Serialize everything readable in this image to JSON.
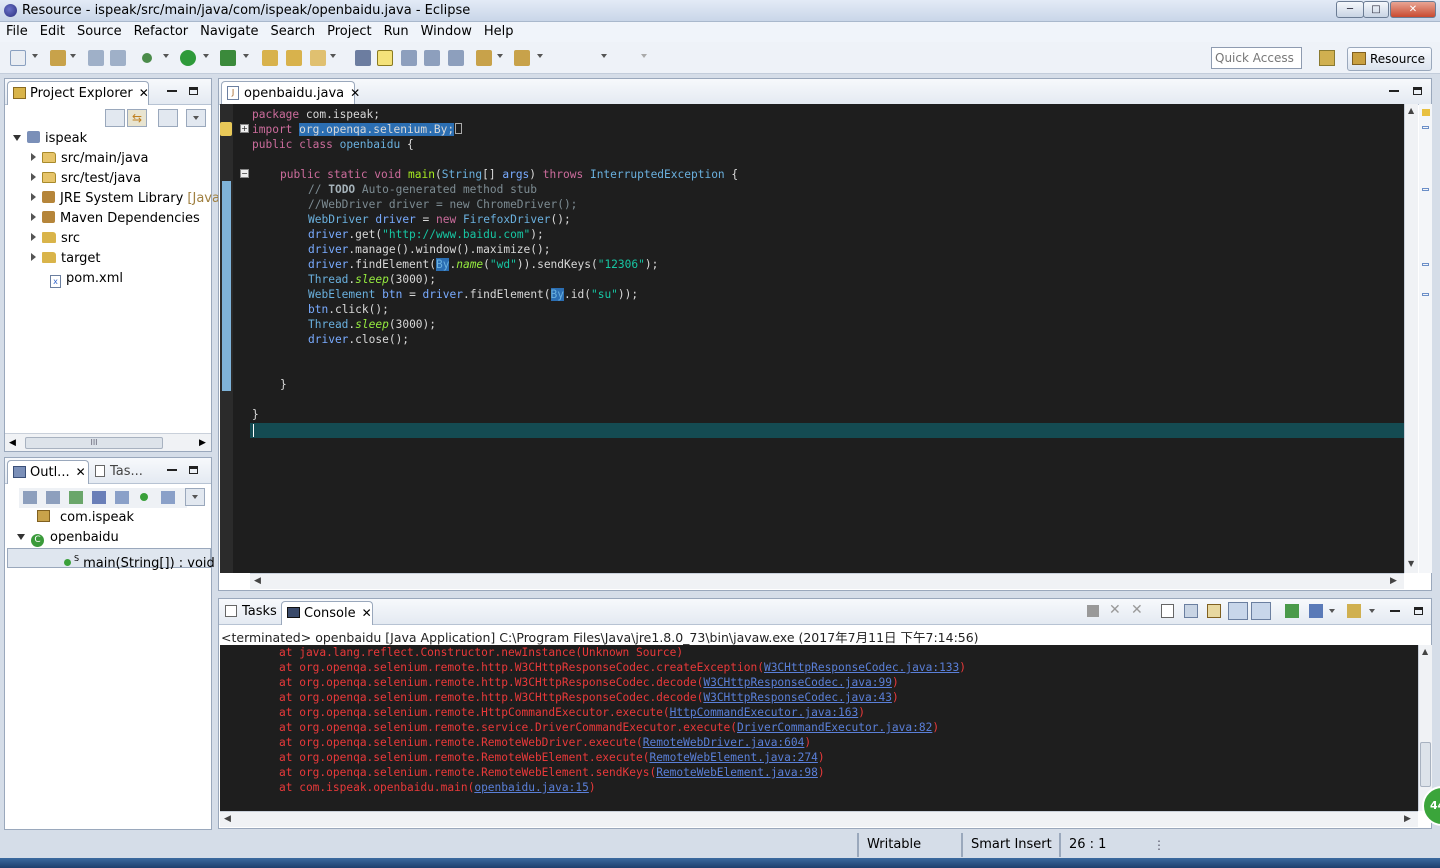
{
  "window": {
    "title": "Resource - ispeak/src/main/java/com/ispeak/openbaidu.java - Eclipse",
    "buttons": {
      "minimize": "─",
      "maximize": "□",
      "close": "✕"
    }
  },
  "menu": [
    "File",
    "Edit",
    "Source",
    "Refactor",
    "Navigate",
    "Search",
    "Project",
    "Run",
    "Window",
    "Help"
  ],
  "toolbar": {
    "quick_access_placeholder": "Quick Access",
    "perspective": "Resource"
  },
  "project_explorer": {
    "title": "Project Explorer",
    "close": "✕",
    "root": "ispeak",
    "items": [
      {
        "label": "src/main/java",
        "suffix": ""
      },
      {
        "label": "src/test/java",
        "suffix": ""
      },
      {
        "label": "JRE System Library",
        "suffix": "[Java"
      },
      {
        "label": "Maven Dependencies",
        "suffix": ""
      },
      {
        "label": "src",
        "suffix": ""
      },
      {
        "label": "target",
        "suffix": ""
      },
      {
        "label": "pom.xml",
        "suffix": ""
      }
    ],
    "hscroll_grip": "III"
  },
  "outline": {
    "tab1": "Outl...",
    "tab2": "Tas...",
    "close": "✕",
    "items": [
      "com.ispeak",
      "openbaidu",
      "main(String[]) : void"
    ]
  },
  "editor": {
    "tab": "openbaidu.java",
    "close": "✕",
    "lines": {
      "l1": {
        "kw": "package",
        "rest": " com.ispeak;"
      },
      "l2": {
        "kw": "import",
        "sp": " ",
        "hl": "org.openqa.selenium.By;"
      },
      "l3": {
        "kw": "public class",
        "sp": " ",
        "name": "openbaidu",
        "rest": " {"
      },
      "l5": {
        "kw1": "public static void",
        "sp": " ",
        "mt": "main",
        "p1": "(",
        "ty": "String",
        "p2": "[] ",
        "vr": "args",
        "p3": ") ",
        "kw2": "throws",
        "sp2": " ",
        "ex": "InterruptedException",
        "p4": " {"
      },
      "l6": {
        "cm": "// ",
        "todo": "TODO",
        "cm2": " Auto-generated method stub"
      },
      "l7": {
        "cm": "//WebDriver driver = new ChromeDriver();"
      },
      "l8": {
        "ty": "WebDriver",
        "sp": " ",
        "vr": "driver",
        "eq": " = ",
        "kw": "new",
        "sp2": " ",
        "ty2": "FirefoxDriver",
        "rest": "();"
      },
      "l9": {
        "vr": "driver",
        "m": ".get(",
        "st": "\"http://www.baidu.com\"",
        "rest": ");"
      },
      "l10": {
        "vr": "driver",
        "rest": ".manage().window().maximize();"
      },
      "l11": {
        "vr": "driver",
        "m": ".findElement(",
        "hl": "By",
        "dot": ".",
        "it": "name",
        "p": "(",
        "st": "\"wd\"",
        "m2": ")).sendKeys(",
        "st2": "\"12306\"",
        "rest": ");"
      },
      "l12": {
        "ty": "Thread",
        "dot": ".",
        "it": "sleep",
        "rest": "(3000);"
      },
      "l13": {
        "ty": "WebElement",
        "sp": " ",
        "vr": "btn",
        "eq": " = ",
        "vr2": "driver",
        "m": ".findElement(",
        "hl": "By",
        "m2": ".id(",
        "st": "\"su\"",
        "rest": "));"
      },
      "l14": {
        "vr": "btn",
        "rest": ".click();"
      },
      "l15": {
        "ty": "Thread",
        "dot": ".",
        "it": "sleep",
        "rest": "(3000);"
      },
      "l16": {
        "vr": "driver",
        "rest": ".close();"
      },
      "l19": {
        "rest": "}"
      },
      "l21": {
        "rest": "}"
      }
    }
  },
  "console": {
    "tab1": "Tasks",
    "tab2": "Console",
    "close": "✕",
    "status": "<terminated> openbaidu [Java Application] C:\\Program Files\\Java\\jre1.8.0_73\\bin\\javaw.exe (2017年7月11日 下午7:14:56)",
    "lines": [
      {
        "text": "at java.lang.reflect.Constructor.newInstance(Unknown Source)",
        "link": "",
        "tail": ""
      },
      {
        "text": "at org.openqa.selenium.remote.http.W3CHttpResponseCodec.createException(",
        "link": "W3CHttpResponseCodec.java:133",
        "tail": ")"
      },
      {
        "text": "at org.openqa.selenium.remote.http.W3CHttpResponseCodec.decode(",
        "link": "W3CHttpResponseCodec.java:99",
        "tail": ")"
      },
      {
        "text": "at org.openqa.selenium.remote.http.W3CHttpResponseCodec.decode(",
        "link": "W3CHttpResponseCodec.java:43",
        "tail": ")"
      },
      {
        "text": "at org.openqa.selenium.remote.HttpCommandExecutor.execute(",
        "link": "HttpCommandExecutor.java:163",
        "tail": ")"
      },
      {
        "text": "at org.openqa.selenium.remote.service.DriverCommandExecutor.execute(",
        "link": "DriverCommandExecutor.java:82",
        "tail": ")"
      },
      {
        "text": "at org.openqa.selenium.remote.RemoteWebDriver.execute(",
        "link": "RemoteWebDriver.java:604",
        "tail": ")"
      },
      {
        "text": "at org.openqa.selenium.remote.RemoteWebElement.execute(",
        "link": "RemoteWebElement.java:274",
        "tail": ")"
      },
      {
        "text": "at org.openqa.selenium.remote.RemoteWebElement.sendKeys(",
        "link": "RemoteWebElement.java:98",
        "tail": ")"
      },
      {
        "text": "at com.ispeak.openbaidu.main(",
        "link": "openbaidu.java:15",
        "tail": ")"
      }
    ]
  },
  "statusbar": {
    "writable": "Writable",
    "insert_mode": "Smart Insert",
    "position": "26 : 1",
    "badge": "44"
  },
  "colors": {
    "editor_bg": "#1e1e1e",
    "error_text": "#e8393a",
    "link": "#5a7fd8",
    "keyword": "#cc6c9c",
    "string": "#17c6a3",
    "current_line": "#144b52"
  }
}
